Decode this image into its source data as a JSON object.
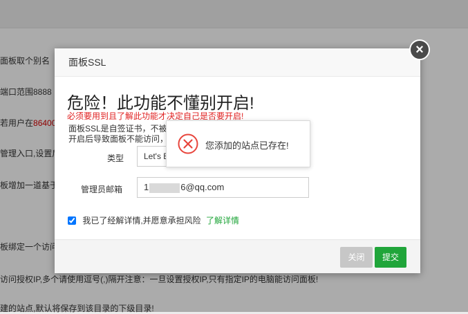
{
  "background": {
    "lines": [
      {
        "text": "面板取个别名",
        "top": 0
      },
      {
        "text": "端口范围8888",
        "top": 0
      },
      {
        "prefix": "若用户在",
        "highlight": "86400"
      },
      {
        "text": "管理入口,设置后"
      },
      {
        "text": "板增加一道基于"
      },
      {
        "text": "板绑定一个访问"
      },
      {
        "text": "访问授权IP,多个请使用逗号(,)隔开注意：一旦设置授权IP,只有指定IP的电脑能访问面板!"
      },
      {
        "text": "建的站点,默认将保存到该目录的下级目录!"
      }
    ]
  },
  "dialog": {
    "title": "面板SSL",
    "close_symbol": "×",
    "warning_title": "危险！此功能不懂别开启!",
    "warning_sub": "必须要用到且了解此功能才决定自己是否要开启!",
    "desc_line1": "面板SSL是自签证书，不被浏",
    "desc_line2": "开启后导致面板不能访问，",
    "type_label": "类型",
    "type_value": "Let's E",
    "email_label": "管理员邮箱",
    "email_prefix": "1",
    "email_suffix": "6@qq.com",
    "agree_text": "我已了经解详情,并愿意承担风险",
    "detail_link": "了解详情",
    "close_button": "关闭",
    "submit_button": "提交"
  },
  "toast": {
    "message": "您添加的站点已存在!",
    "icon": "error-circle-icon",
    "icon_color": "#e8453c"
  },
  "colors": {
    "accent_green": "#20a53a",
    "warning_red": "#e02020"
  }
}
